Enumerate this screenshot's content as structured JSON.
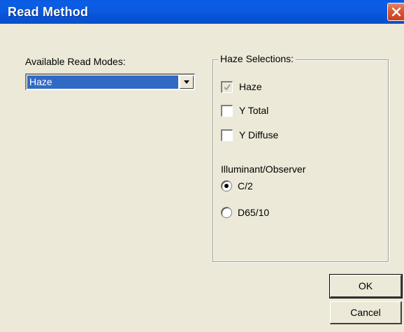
{
  "window": {
    "title": "Read Method"
  },
  "read_modes": {
    "label": "Available Read Modes:",
    "selected": "Haze"
  },
  "haze_selections": {
    "legend": "Haze Selections:",
    "checkboxes": [
      {
        "label": "Haze",
        "checked": true,
        "disabled": true
      },
      {
        "label": "Y Total",
        "checked": false,
        "disabled": false
      },
      {
        "label": "Y Diffuse",
        "checked": false,
        "disabled": false
      }
    ],
    "illuminant_label": "Illuminant/Observer",
    "radios": [
      {
        "label": "C/2",
        "selected": true
      },
      {
        "label": "D65/10",
        "selected": false
      }
    ]
  },
  "buttons": {
    "ok": "OK",
    "cancel": "Cancel"
  },
  "colors": {
    "titlebar": "#0a58e0",
    "selection": "#316ac5",
    "close": "#dc5a35",
    "dialog_bg": "#ece9d8"
  }
}
